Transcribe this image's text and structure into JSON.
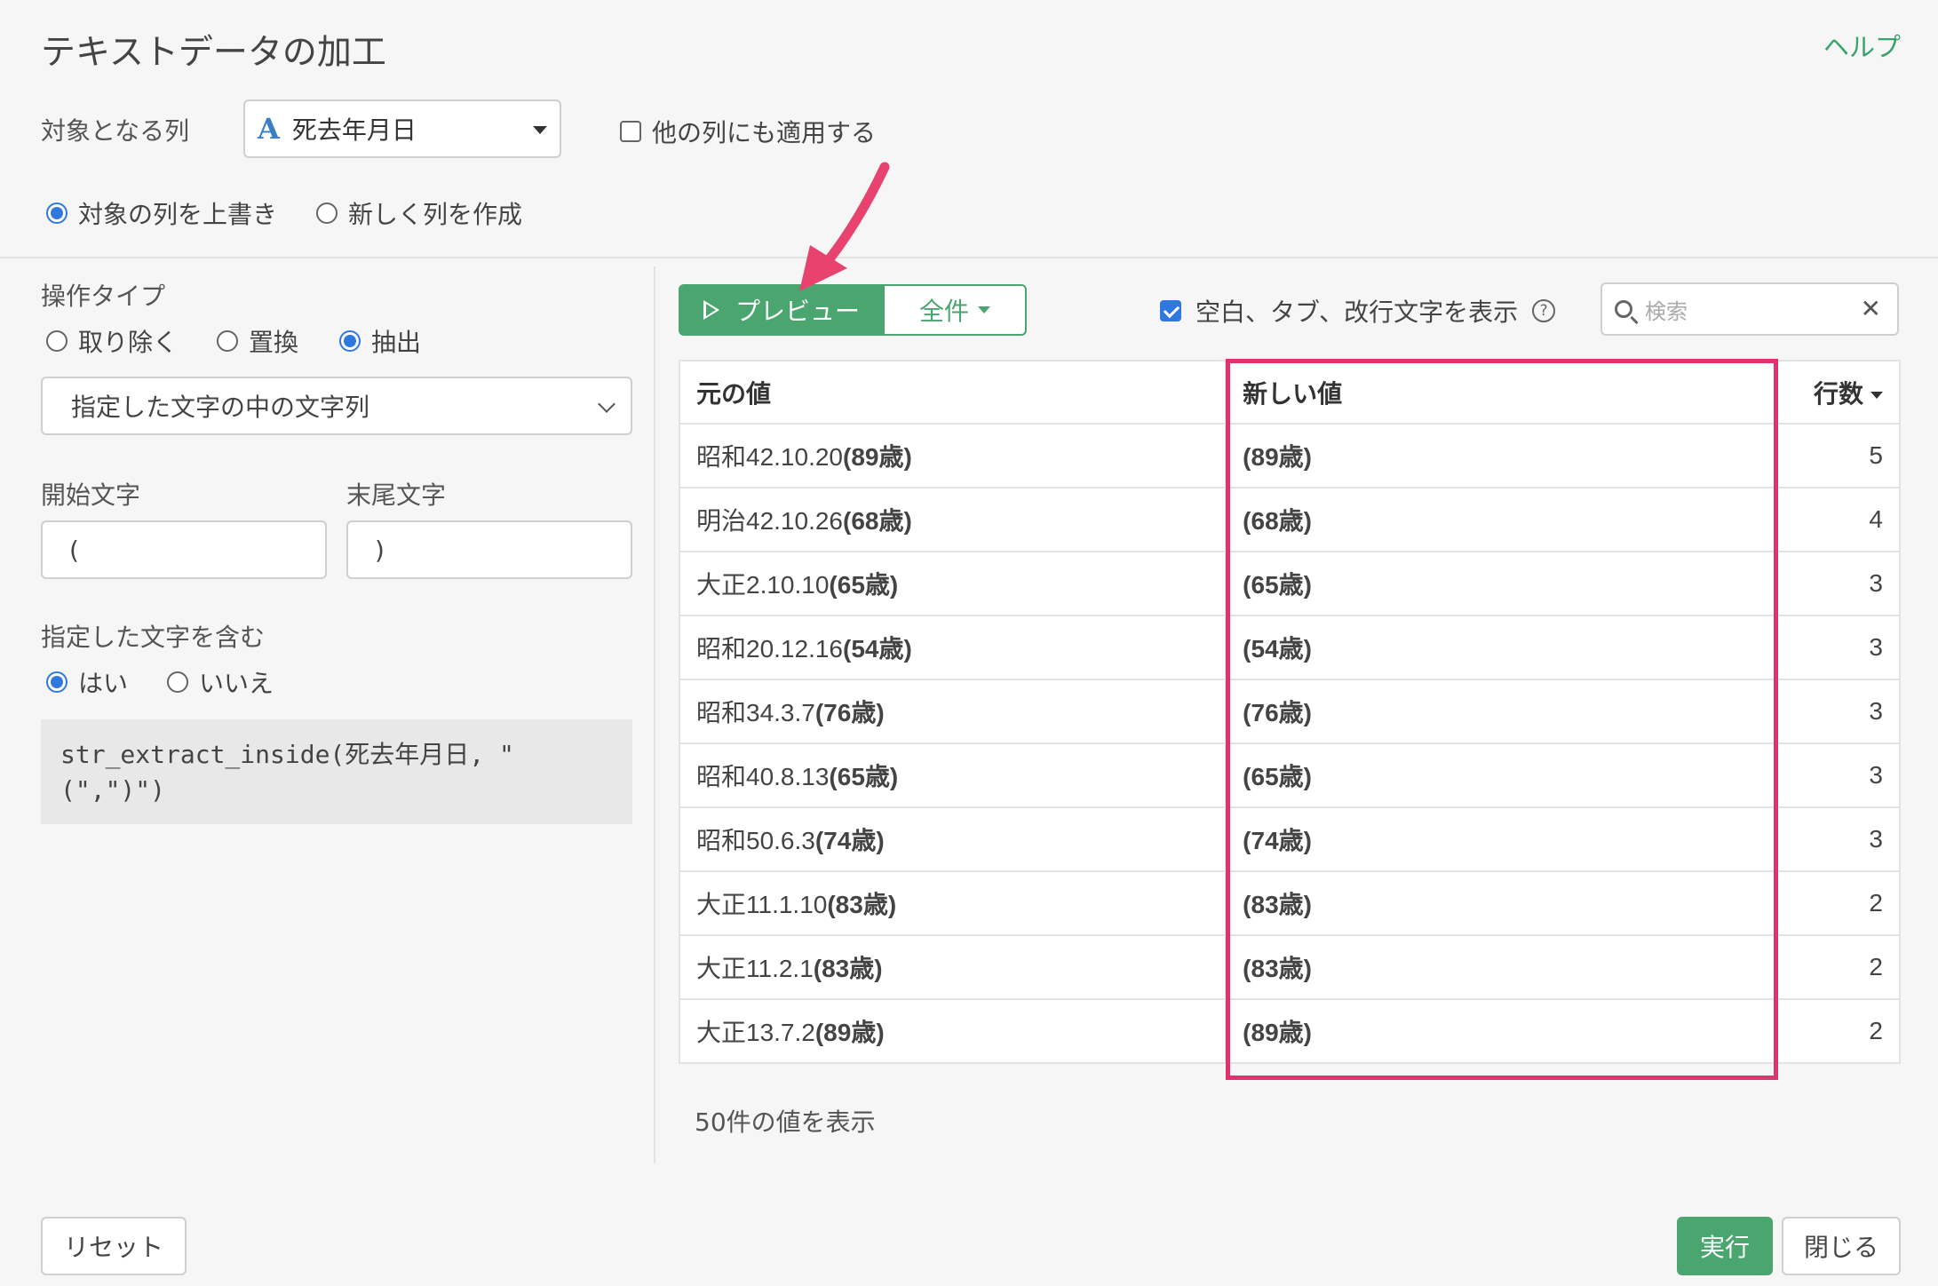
{
  "header": {
    "title": "テキストデータの加工",
    "help": "ヘルプ"
  },
  "target": {
    "label": "対象となる列",
    "column_type_icon": "A",
    "column": "死去年月日",
    "apply_other_label": "他の列にも適用する"
  },
  "output_mode": {
    "overwrite_label": "対象の列を上書き",
    "new_column_label": "新しく列を作成",
    "selected": "overwrite"
  },
  "operation": {
    "label": "操作タイプ",
    "options": [
      "取り除く",
      "置換",
      "抽出"
    ],
    "selected": "抽出",
    "method": "指定した文字の中の文字列"
  },
  "start_char": {
    "label": "開始文字",
    "value": "("
  },
  "end_char": {
    "label": "末尾文字",
    "value": ")"
  },
  "include": {
    "label": "指定した文字を含む",
    "yes": "はい",
    "no": "いいえ",
    "selected": "はい"
  },
  "code": "str_extract_inside(死去年月日, \"(\",\")\")",
  "preview": {
    "preview_label": "プレビュー",
    "all_label": "全件",
    "show_whitespace_label": "空白、タブ、改行文字を表示",
    "show_whitespace_checked": true,
    "search_placeholder": "検索"
  },
  "table": {
    "headers": {
      "original": "元の値",
      "new": "新しい値",
      "count": "行数"
    },
    "rows": [
      {
        "orig_prefix": "昭和42.10.20",
        "orig_bold": "(89歳)",
        "new": "(89歳)",
        "count": "5"
      },
      {
        "orig_prefix": "明治42.10.26",
        "orig_bold": "(68歳)",
        "new": "(68歳)",
        "count": "4"
      },
      {
        "orig_prefix": "大正2.10.10",
        "orig_bold": "(65歳)",
        "new": "(65歳)",
        "count": "3"
      },
      {
        "orig_prefix": "昭和20.12.16",
        "orig_bold": "(54歳)",
        "new": "(54歳)",
        "count": "3"
      },
      {
        "orig_prefix": "昭和34.3.7",
        "orig_bold": "(76歳)",
        "new": "(76歳)",
        "count": "3"
      },
      {
        "orig_prefix": "昭和40.8.13",
        "orig_bold": "(65歳)",
        "new": "(65歳)",
        "count": "3"
      },
      {
        "orig_prefix": "昭和50.6.3",
        "orig_bold": "(74歳)",
        "new": "(74歳)",
        "count": "3"
      },
      {
        "orig_prefix": "大正11.1.10",
        "orig_bold": "(83歳)",
        "new": "(83歳)",
        "count": "2"
      },
      {
        "orig_prefix": "大正11.2.1",
        "orig_bold": "(83歳)",
        "new": "(83歳)",
        "count": "2"
      },
      {
        "orig_prefix": "大正13.7.2",
        "orig_bold": "(89歳)",
        "new": "(89歳)",
        "count": "2"
      }
    ],
    "footer": "50件の値を表示"
  },
  "buttons": {
    "reset": "リセット",
    "run": "実行",
    "close": "閉じる"
  },
  "colors": {
    "accent_green": "#4aa56f",
    "highlight_pink": "#e0336e",
    "radio_blue": "#2f78e0"
  }
}
